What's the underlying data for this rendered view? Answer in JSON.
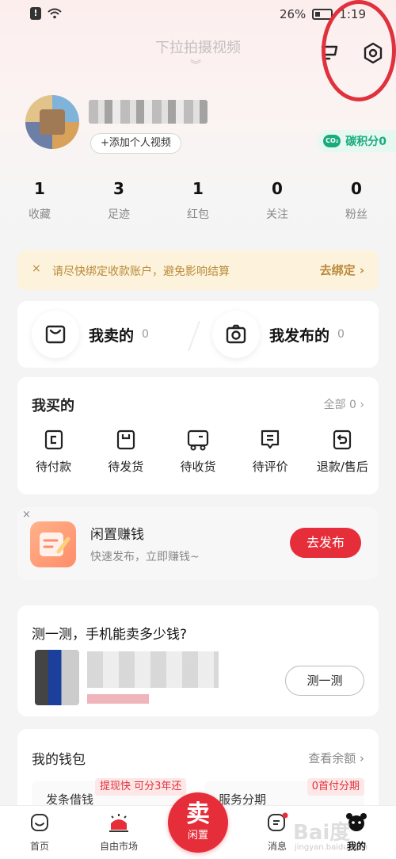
{
  "status_bar": {
    "battery": "26%",
    "time": "1:19"
  },
  "header": {
    "pull_hint": "下拉拍摄视频",
    "cart_icon": "cart-icon",
    "settings_icon": "hexagon-settings-icon"
  },
  "profile": {
    "add_video_label": "+添加个人视频",
    "carbon_label": "碳积分0"
  },
  "stats": [
    {
      "num": "1",
      "label": "收藏"
    },
    {
      "num": "3",
      "label": "足迹"
    },
    {
      "num": "1",
      "label": "红包"
    },
    {
      "num": "0",
      "label": "关注"
    },
    {
      "num": "0",
      "label": "粉丝"
    }
  ],
  "notice": {
    "close": "×",
    "text": "请尽快绑定收款账户，避免影响结算",
    "action": "去绑定 ›"
  },
  "sell": {
    "sold_label": "我卖的",
    "sold_count": "0",
    "published_label": "我发布的",
    "published_count": "0"
  },
  "bought": {
    "title": "我买的",
    "all_label": "全部 0 ›",
    "items": [
      "待付款",
      "待发货",
      "待收货",
      "待评价",
      "退款/售后"
    ]
  },
  "idle": {
    "close": "×",
    "title": "闲置赚钱",
    "subtitle": "快速发布，立即赚钱~",
    "button": "去发布"
  },
  "test_phone": {
    "title": "测一测，手机能卖多少钱?",
    "button": "测一测"
  },
  "wallet": {
    "title": "我的钱包",
    "link": "查看余额 ›",
    "left_text": "发条借钱",
    "tag_left": "提现快 可分3年还",
    "right_text": "服务分期",
    "tag_right": "0首付分期"
  },
  "tabbar": {
    "home": "首页",
    "market": "自由市场",
    "sell_big": "卖",
    "sell_small": "闲置",
    "messages": "消息",
    "mine": "我的"
  },
  "watermark": {
    "main": "Bai度",
    "sub": "jingyan.baidu.com"
  },
  "colors": {
    "accent": "#e62e3a",
    "carbon_green": "#1aab7d",
    "notice_bg": "#fdf3dc"
  }
}
